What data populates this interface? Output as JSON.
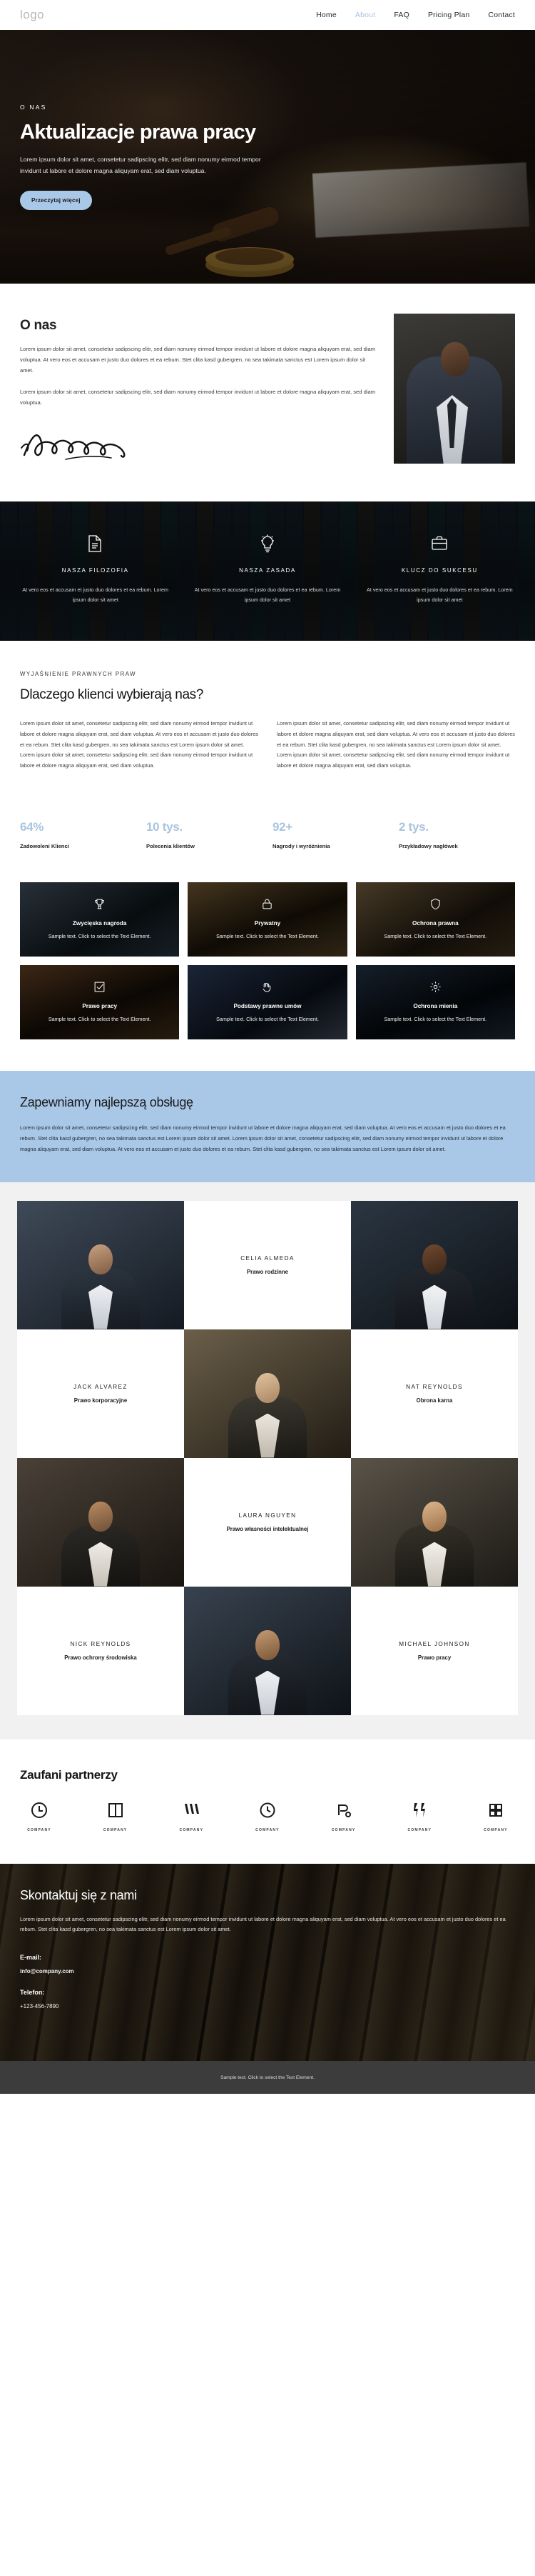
{
  "header": {
    "logo": "logo",
    "nav": [
      {
        "label": "Home",
        "active": false
      },
      {
        "label": "About",
        "active": true
      },
      {
        "label": "FAQ",
        "active": false
      },
      {
        "label": "Pricing Plan",
        "active": false
      },
      {
        "label": "Contact",
        "active": false
      }
    ]
  },
  "hero": {
    "eyebrow": "O NAS",
    "title": "Aktualizacje prawa pracy",
    "subtitle": "Lorem ipsum dolor sit amet, consetetur sadipscing elitr, sed diam nonumy eirmod tempor invidunt ut labore et dolore magna aliquyam erat, sed diam voluptua.",
    "button": "Przeczytaj więcej"
  },
  "about": {
    "heading": "O nas",
    "paragraph1": "Lorem ipsum dolor sit amet, consetetur sadipscing elitr, sed diam nonumy eirmod tempor invidunt ut labore et dolore magna aliquyam erat, sed diam voluptua. At vero eos et accusam et justo duo dolores et ea rebum. Stet clita kasd gubergren, no sea takimata sanctus est Lorem ipsum dolor sit amet.",
    "paragraph2": "Lorem ipsum dolor sit amet, consetetur sadipscing elitr, sed diam nonumy eirmod tempor invidunt ut labore et dolore magna aliquyam erat, sed diam voluptua.",
    "signature": "D. Nofoward"
  },
  "features": [
    {
      "icon": "document-icon",
      "title": "NASZA FILOZOFIA",
      "text": "At vero eos et accusam et justo duo dolores et ea rebum. Lorem ipsum dolor sit amet"
    },
    {
      "icon": "lightbulb-icon",
      "title": "NASZA ZASADA",
      "text": "At vero eos et accusam et justo duo dolores et ea rebum. Lorem ipsum dolor sit amet"
    },
    {
      "icon": "briefcase-icon",
      "title": "KLUCZ DO SUKCESU",
      "text": "At vero eos et accusam et justo duo dolores et ea rebum. Lorem ipsum dolor sit amet"
    }
  ],
  "why": {
    "eyebrow": "WYJAŚNIENIE PRAWNYCH PRAW",
    "heading": "Dlaczego klienci wybierają nas?",
    "col1": "Lorem ipsum dolor sit amet, consetetur sadipscing elitr, sed diam nonumy eirmod tempor invidunt ut labore et dolore magna aliquyam erat, sed diam voluptua. At vero eos et accusam et justo duo dolores et ea rebum. Stet clita kasd gubergren, no sea takimata sanctus est Lorem ipsum dolor sit amet. Lorem ipsum dolor sit amet, consetetur sadipscing elitr, sed diam nonumy eirmod tempor invidunt ut labore et dolore magna aliquyam erat, sed diam voluptua.",
    "col2": "Lorem ipsum dolor sit amet, consetetur sadipscing elitr, sed diam nonumy eirmod tempor invidunt ut labore et dolore magna aliquyam erat, sed diam voluptua. At vero eos et accusam et justo duo dolores et ea rebum. Stet clita kasd gubergren, no sea takimata sanctus est Lorem ipsum dolor sit amet. Lorem ipsum dolor sit amet, consetetur sadipscing elitr, sed diam nonumy eirmod tempor invidunt ut labore et dolore magna aliquyam erat, sed diam voluptua."
  },
  "stats": [
    {
      "number": "64%",
      "label": "Zadowoleni Klienci"
    },
    {
      "number": "10 tys.",
      "label": "Polecenia klientów"
    },
    {
      "number": "92+",
      "label": "Nagrody i wyróżnienia"
    },
    {
      "number": "2 tys.",
      "label": "Przykładowy nagłówek"
    }
  ],
  "cards": [
    {
      "icon": "trophy-icon",
      "title": "Zwycięska nagroda",
      "text": "Sample text. Click to select the Text Element."
    },
    {
      "icon": "lock-icon",
      "title": "Prywatny",
      "text": "Sample text. Click to select the Text Element."
    },
    {
      "icon": "shield-icon",
      "title": "Ochrona prawna",
      "text": "Sample text. Click to select the Text Element."
    },
    {
      "icon": "check-square-icon",
      "title": "Prawo pracy",
      "text": "Sample text. Click to select the Text Element."
    },
    {
      "icon": "handshake-icon",
      "title": "Podstawy prawne umów",
      "text": "Sample text. Click to select the Text Element."
    },
    {
      "icon": "gear-icon",
      "title": "Ochrona mienia",
      "text": "Sample text. Click to select the Text Element."
    }
  ],
  "blue": {
    "heading": "Zapewniamy najlepszą obsługę",
    "text": "Lorem ipsum dolor sit amet, consetetur sadipscing elitr, sed diam nonumy eirmod tempor invidunt ut labore et dolore magna aliquyam erat, sed diam voluptua. At vero eos et accusam et justo duo dolores et ea rebum. Stet clita kasd gubergren, no sea takimata sanctus est Lorem ipsum dolor sit amet. Lorem ipsum dolor sit amet, consetetur sadipscing elitr, sed diam nonumy eirmod tempor invidunt ut labore et dolore magna aliquyam erat, sed diam voluptua. At vero eos et accusam et justo duo dolores et ea rebum. Stet clita kasd gubergren, no sea takimata sanctus est Lorem ipsum dolor sit amet."
  },
  "team": [
    {
      "name": "CELIA ALMEDA",
      "role": "Prawo rodzinne"
    },
    {
      "name": "JACK ALVAREZ",
      "role": "Prawo korporacyjne"
    },
    {
      "name": "NAT REYNOLDS",
      "role": "Obrona karna"
    },
    {
      "name": "LAURA NGUYEN",
      "role": "Prawo własności intelektualnej"
    },
    {
      "name": "NICK REYNOLDS",
      "role": "Prawo ochrony środowiska"
    },
    {
      "name": "MICHAEL JOHNSON",
      "role": "Prawo pracy"
    }
  ],
  "partners": {
    "heading": "Zaufani partnerzy",
    "logos": [
      {
        "icon": "circle-monogram-icon",
        "name": "COMPANY"
      },
      {
        "icon": "book-icon",
        "name": "COMPANY"
      },
      {
        "icon": "flag-icon",
        "name": "COMPANY"
      },
      {
        "icon": "clock-icon",
        "name": "COMPANY"
      },
      {
        "icon": "node-icon",
        "name": "COMPANY"
      },
      {
        "icon": "bolt-icon",
        "name": "COMPANY"
      },
      {
        "icon": "grid-icon",
        "name": "COMPANY"
      }
    ]
  },
  "contact": {
    "heading": "Skontaktuj się z nami",
    "text": "Lorem ipsum dolor sit amet, consetetur sadipscing elitr, sed diam nonumy eirmod tempor invidunt ut labore et dolore magna aliquyam erat, sed diam voluptua. At vero eos et accusam et justo duo dolores et ea rebum. Stet clita kasd gubergren, no sea takimata sanctus est Lorem ipsum dolor sit amet.",
    "email_label": "E-mail:",
    "email_value": "info@company.com",
    "phone_label": "Telefon:",
    "phone_value": "+123-456-7890"
  },
  "footer": {
    "text": "Sample text. Click to select the Text Element."
  },
  "colors": {
    "accent": "#a9c8e8",
    "stat": "#a9c4de",
    "footer_bg": "#3c3c3c",
    "dark": "#0d1116"
  }
}
